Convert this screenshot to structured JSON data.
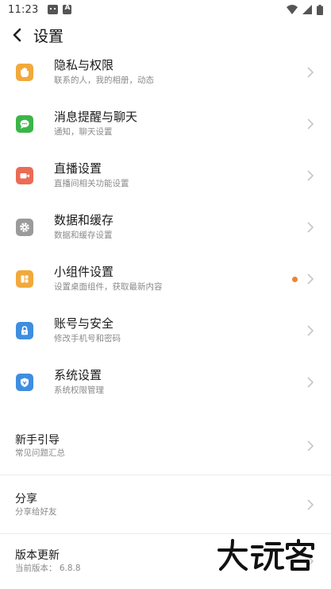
{
  "status_bar": {
    "time": "11:23",
    "notification_icons": [
      "face-icon",
      "a-icon"
    ],
    "right_icons": [
      "wifi-icon",
      "signal-icon",
      "battery-icon"
    ]
  },
  "header": {
    "title": "设置",
    "back_icon": "arrow-left-icon"
  },
  "settings": [
    {
      "id": "privacy",
      "title": "隐私与权限",
      "subtitle": "联系的人，我的相册，动态",
      "icon": "hand-icon",
      "color": "#f2a93b"
    },
    {
      "id": "messages",
      "title": "消息提醒与聊天",
      "subtitle": "通知，聊天设置",
      "icon": "chat-icon",
      "color": "#3bb54a"
    },
    {
      "id": "live",
      "title": "直播设置",
      "subtitle": "直播间相关功能设置",
      "icon": "video-icon",
      "color": "#ec6b55"
    },
    {
      "id": "storage",
      "title": "数据和缓存",
      "subtitle": "数据和缓存设置",
      "icon": "gear-icon",
      "color": "#9b9b9b"
    },
    {
      "id": "widgets",
      "title": "小组件设置",
      "subtitle": "设置桌面组件，获取最新内容",
      "icon": "widget-icon",
      "color": "#f2a93b",
      "has_dot": true
    },
    {
      "id": "account",
      "title": "账号与安全",
      "subtitle": "修改手机号和密码",
      "icon": "lock-icon",
      "color": "#3e8ee0"
    },
    {
      "id": "system",
      "title": "系统设置",
      "subtitle": "系统权限管理",
      "icon": "shield-icon",
      "color": "#3e8ee0"
    }
  ],
  "guide": {
    "title": "新手引导",
    "subtitle": "常见问题汇总"
  },
  "share": {
    "title": "分享",
    "subtitle": "分享给好友"
  },
  "update": {
    "title": "版本更新",
    "subtitle": "当前版本：  6.8.8"
  },
  "watermark": "大玩客",
  "colors": {
    "badge_dot": "#f0842f",
    "chevron": "#c6c6c6"
  }
}
